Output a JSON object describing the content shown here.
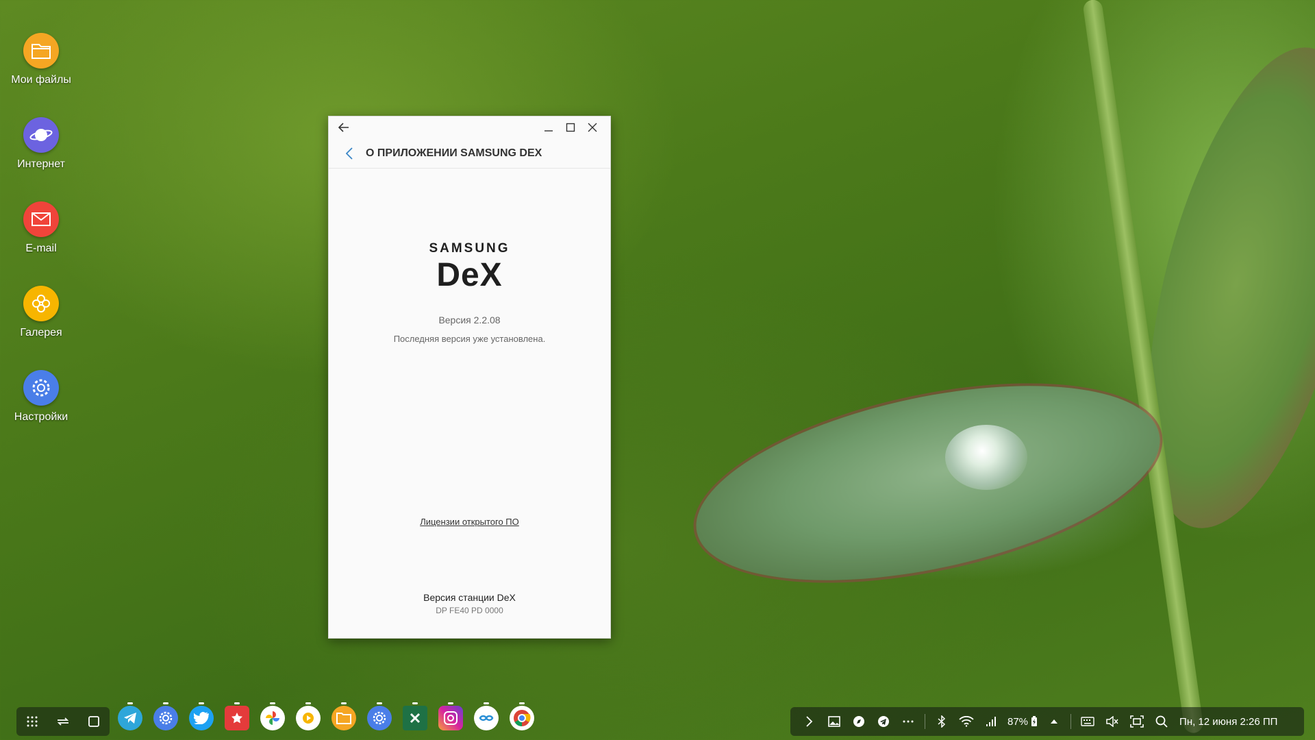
{
  "desktop": {
    "icons": [
      {
        "label": "Мои файлы",
        "color": "#f5a623",
        "icon": "folder-icon"
      },
      {
        "label": "Интернет",
        "color": "#6c63e0",
        "icon": "planet-icon"
      },
      {
        "label": "E-mail",
        "color": "#f0443a",
        "icon": "envelope-icon"
      },
      {
        "label": "Галерея",
        "color": "#f7b500",
        "icon": "flower-icon"
      },
      {
        "label": "Настройки",
        "color": "#4a7ee8",
        "icon": "gear-icon"
      }
    ]
  },
  "window": {
    "title": "О ПРИЛОЖЕНИИ SAMSUNG DEX",
    "logo_top": "SAMSUNG",
    "logo_main": "DeX",
    "version": "Версия 2.2.08",
    "latest_status": "Последняя версия уже установлена.",
    "licenses_link": "Лицензии открытого ПО",
    "station_title": "Версия станции DeX",
    "station_value": "DP FE40  PD 0000"
  },
  "taskbar": {
    "apps": [
      {
        "name": "telegram-app",
        "color": "#2ea6da"
      },
      {
        "name": "settings-app",
        "color": "#4a7ee8"
      },
      {
        "name": "twitter-app",
        "color": "#1da1f2"
      },
      {
        "name": "star-app",
        "color": "#e43b3b"
      },
      {
        "name": "photos-app",
        "color": "#ffffff"
      },
      {
        "name": "play-app",
        "color": "#f7b500"
      },
      {
        "name": "files-app",
        "color": "#f5a623"
      },
      {
        "name": "settings-app-2",
        "color": "#4a7ee8"
      },
      {
        "name": "excel-app",
        "color": "#1e7145"
      },
      {
        "name": "instagram-app",
        "color": "#d6249f"
      },
      {
        "name": "sync-app",
        "color": "#ffffff"
      },
      {
        "name": "chrome-app",
        "color": "#ffffff"
      }
    ],
    "battery": "87%",
    "datetime": "Пн, 12 июня  2:26 ПП"
  }
}
